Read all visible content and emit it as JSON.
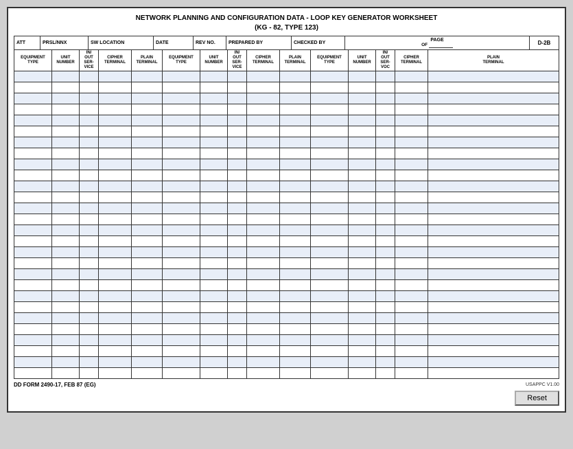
{
  "title": {
    "line1": "NETWORK PLANNING AND CONFIGURATION DATA - LOOP KEY GENERATOR WORKSHEET",
    "line2": "(KG - 82, TYPE 123)"
  },
  "header": {
    "att_label": "ATT",
    "prsl_label": "PRSL/NNX",
    "sw_label": "SW LOCATION",
    "date_label": "DATE",
    "rev_label": "REV NO.",
    "prepared_label": "PREPARED BY",
    "checked_label": "CHECKED BY",
    "page_label": "PAGE",
    "of_label": "OF",
    "d2b_label": "D-2B"
  },
  "columns": [
    {
      "id": "eq-type-1",
      "label": "EQUIPMENT TYPE"
    },
    {
      "id": "unit-num-1",
      "label": "UNIT NUMBER"
    },
    {
      "id": "in-out-1",
      "label": "IN/ OUT SER- VICE"
    },
    {
      "id": "cipher-1",
      "label": "CIPHER TERMINAL"
    },
    {
      "id": "plain-1",
      "label": "PLAIN TERMINAL"
    },
    {
      "id": "eq-type-2",
      "label": "EQUIPMENT TYPE"
    },
    {
      "id": "unit-num-2",
      "label": "UNIT NUMBER"
    },
    {
      "id": "in-out-2",
      "label": "IN/ OUT SER- VICE"
    },
    {
      "id": "cipher-2",
      "label": "CIPHER TERMINAL"
    },
    {
      "id": "plain-2",
      "label": "PLAIN TERMINAL"
    },
    {
      "id": "eq-type-3",
      "label": "EQUIPMENT TYPE"
    },
    {
      "id": "unit-num-3",
      "label": "UNIT NUMBER"
    },
    {
      "id": "in-out-3",
      "label": "IN/ OUT SER- VOC"
    },
    {
      "id": "cipher-3",
      "label": "CIPHER TERMINAL"
    },
    {
      "id": "plain-3",
      "label": "PLAIN TERMINAL"
    }
  ],
  "num_data_rows": 28,
  "footer": {
    "form_number": "DD FORM 2490-17, FEB 87 (EG)",
    "usappc": "USAPPC V1.00",
    "reset_label": "Reset"
  }
}
